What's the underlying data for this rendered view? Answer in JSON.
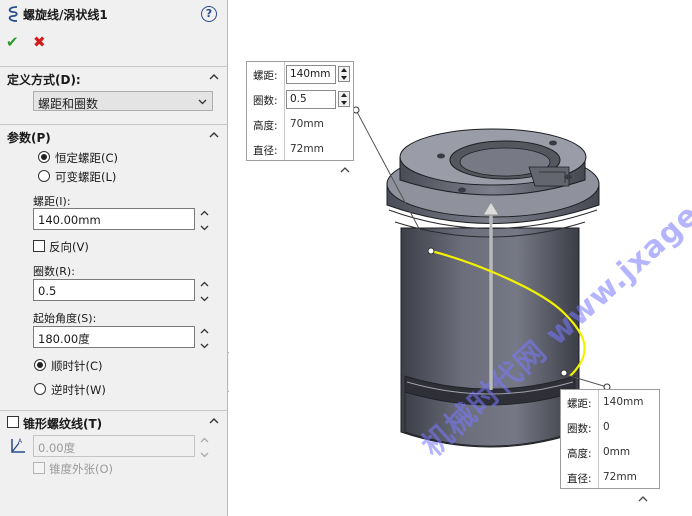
{
  "header": {
    "title": "螺旋线/涡状线1",
    "help": "?",
    "ok": "✔",
    "cancel": "✖"
  },
  "definition": {
    "section_label": "定义方式(D):",
    "selected": "螺距和圈数"
  },
  "parameters": {
    "section_label": "参数(P)",
    "constant_pitch": "恒定螺距(C)",
    "variable_pitch": "可变螺距(L)",
    "pitch_label": "螺距(I):",
    "pitch_value": "140.00mm",
    "reverse": "反向(V)",
    "revolutions_label": "圈数(R):",
    "revolutions_value": "0.5",
    "start_angle_label": "起始角度(S):",
    "start_angle_value": "180.00度",
    "clockwise": "顺时针(C)",
    "counterclockwise": "逆时针(W)"
  },
  "taper": {
    "section_label": "锥形螺纹线(T)",
    "angle_value": "0.00度",
    "taper_outward": "锥度外张(O)"
  },
  "callout_top": {
    "rows": [
      {
        "k": "螺距:",
        "v": "140mm"
      },
      {
        "k": "圈数:",
        "v": "0.5"
      },
      {
        "k": "高度:",
        "v": "70mm"
      },
      {
        "k": "直径:",
        "v": "72mm"
      }
    ]
  },
  "callout_bottom": {
    "rows": [
      {
        "k": "螺距:",
        "v": "140mm"
      },
      {
        "k": "圈数:",
        "v": "0"
      },
      {
        "k": "高度:",
        "v": "0mm"
      },
      {
        "k": "直径:",
        "v": "72mm"
      }
    ]
  },
  "watermark": "机械时代网 www.jxage.com",
  "colors": {
    "helix": "#f2f200",
    "body": "#5f6270",
    "body_light": "#8a8d98",
    "body_dark": "#3b3d46",
    "ok": "#2e9a2e",
    "cancel": "#d41b1b",
    "accent": "#2a4a8a"
  }
}
